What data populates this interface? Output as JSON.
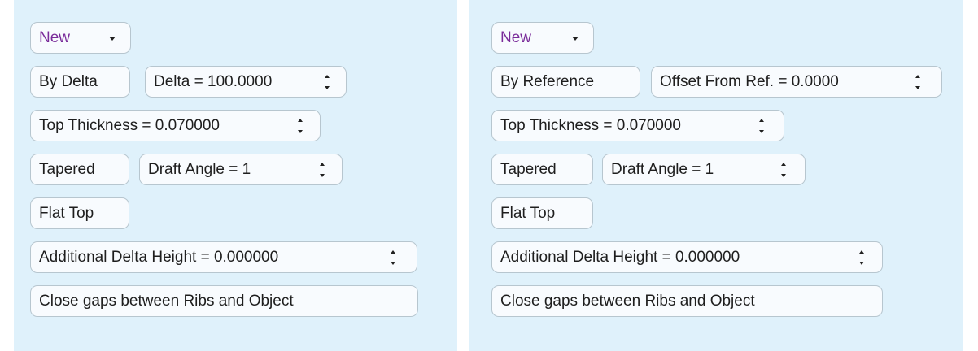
{
  "left": {
    "new_label": "New",
    "mode_label": "By Delta",
    "mode_value": "Delta = 100.0000",
    "top_thickness": "Top Thickness = 0.070000",
    "tapered_label": "Tapered",
    "draft_angle": "Draft Angle = 1",
    "flat_top_label": "Flat Top",
    "additional_delta": "Additional Delta Height  = 0.000000",
    "close_gaps_label": "Close gaps between Ribs and Object"
  },
  "right": {
    "new_label": "New",
    "mode_label": "By Reference",
    "mode_value": "Offset From Ref. = 0.0000",
    "top_thickness": "Top Thickness = 0.070000",
    "tapered_label": "Tapered",
    "draft_angle": "Draft Angle = 1",
    "flat_top_label": "Flat Top",
    "additional_delta": "Additional Delta Height  = 0.000000",
    "close_gaps_label": "Close gaps between Ribs and Object"
  },
  "colors": {
    "panel_background": "#dff1fb",
    "control_background": "#f8fbfe",
    "new_text": "#7a2c9a"
  }
}
